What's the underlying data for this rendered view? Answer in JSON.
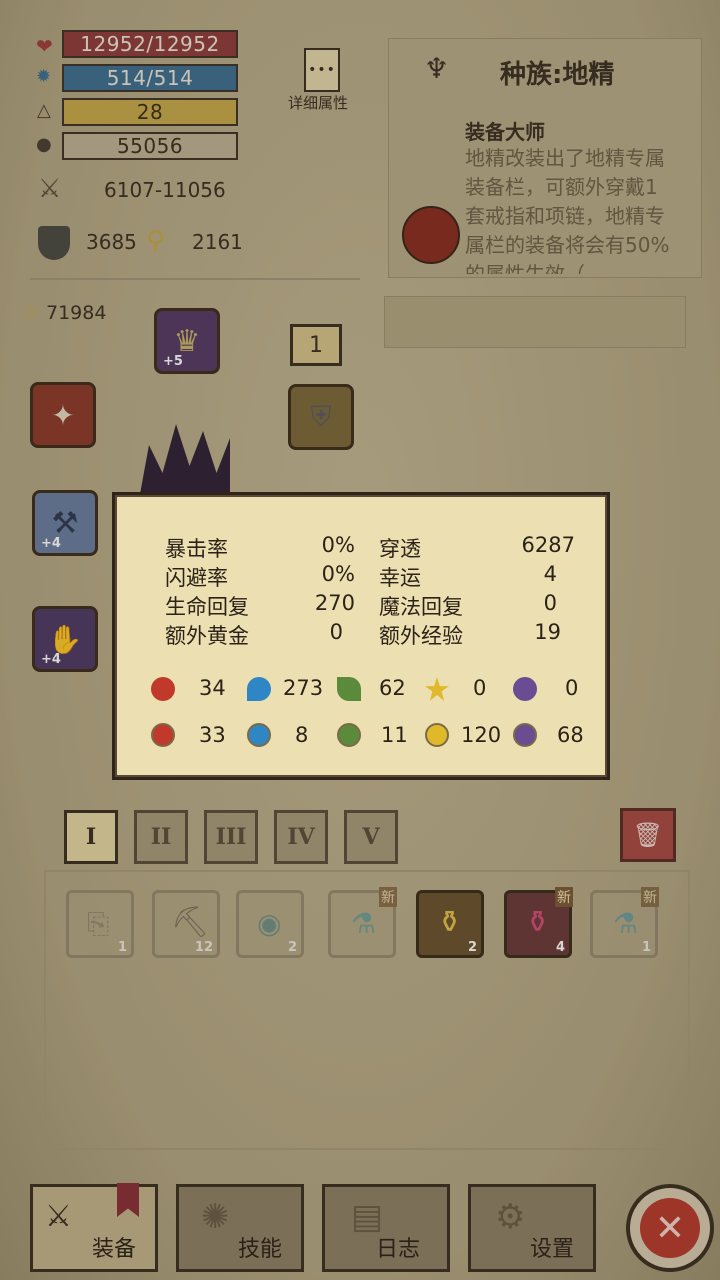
{
  "stats": {
    "hp": "12952/12952",
    "mp": "514/514",
    "level": "28",
    "gold": "55056",
    "attack": "6107-11056",
    "defense": "3685",
    "magic": "2161",
    "detail_label": "详细属性"
  },
  "race": {
    "title": "种族:地精",
    "skill_name": "装备大师",
    "skill_desc": "地精改装出了地精专属装备栏，可额外穿戴1套戒指和项链，地精专属栏的装备将会有50%的属性生效（"
  },
  "equipment": {
    "score": "71984",
    "helmet_plus": "+5",
    "weapon_plus": "+4",
    "glove_plus": "+4",
    "badge": "1"
  },
  "popup": {
    "rows": [
      {
        "l1": "暴击率",
        "v1": "0%",
        "l2": "穿透",
        "v2": "6287"
      },
      {
        "l1": "闪避率",
        "v1": "0%",
        "l2": "幸运",
        "v2": "4"
      },
      {
        "l1": "生命回复",
        "v1": "270",
        "l2": "魔法回复",
        "v2": "0"
      },
      {
        "l1": "额外黄金",
        "v1": "0",
        "l2": "额外经验",
        "v2": "19"
      }
    ],
    "attack_elements": [
      "34",
      "273",
      "62",
      "0",
      "0"
    ],
    "resist_elements": [
      "33",
      "8",
      "11",
      "120",
      "68"
    ]
  },
  "tabs": [
    "I",
    "II",
    "III",
    "IV",
    "V"
  ],
  "items": [
    {
      "count": "1",
      "new": ""
    },
    {
      "count": "12",
      "new": ""
    },
    {
      "count": "2",
      "new": ""
    },
    {
      "count": "",
      "new": "新"
    },
    {
      "count": "2",
      "new": ""
    },
    {
      "count": "4",
      "new": "新"
    },
    {
      "count": "1",
      "new": "新"
    }
  ],
  "nav": {
    "equip": "装备",
    "skills": "技能",
    "log": "日志",
    "settings": "设置"
  },
  "colors": {
    "hp": "#8f3c3c",
    "mp": "#3e6f92",
    "level": "#c7a94b",
    "fire": "#c0392b",
    "water": "#2f86c5",
    "nature": "#5a8a3a",
    "light": "#e0b92a",
    "dark": "#6a4c93"
  }
}
